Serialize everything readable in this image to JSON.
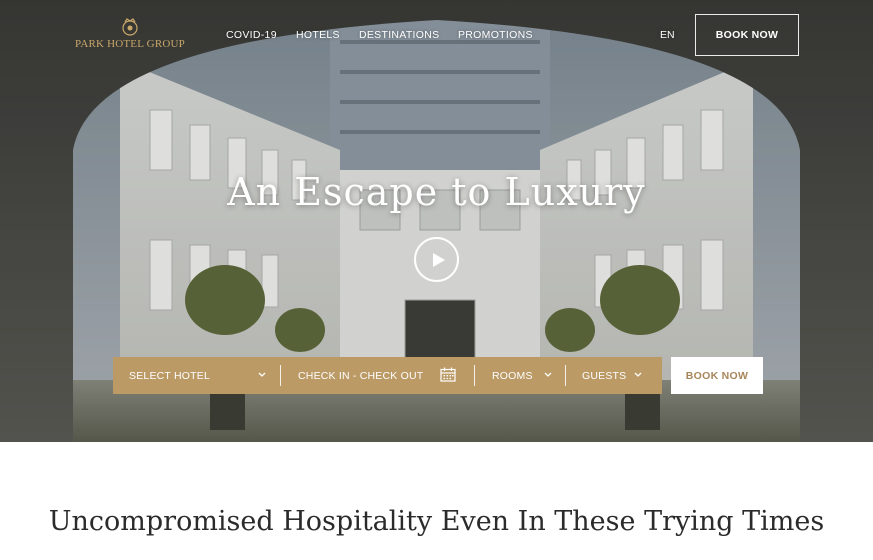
{
  "brand": {
    "logo_text": "PARK HOTEL GROUP",
    "gold": "#c9a86a",
    "booking_bar_color": "#bb9a66",
    "book_now_text_color": "#a8865a"
  },
  "nav": {
    "items": [
      {
        "label": "COVID-19"
      },
      {
        "label": "HOTELS"
      },
      {
        "label": "DESTINATIONS"
      },
      {
        "label": "PROMOTIONS"
      }
    ],
    "language": "EN",
    "book_now": "BOOK NOW"
  },
  "hero": {
    "title": "An Escape to Luxury",
    "play_icon": "play-icon"
  },
  "booking": {
    "hotel": {
      "label": "SELECT HOTEL",
      "icon": "chevron-down-icon"
    },
    "dates": {
      "label": "CHECK IN - CHECK OUT",
      "icon": "calendar-icon"
    },
    "rooms": {
      "label": "ROOMS",
      "icon": "chevron-down-icon"
    },
    "guests": {
      "label": "GUESTS",
      "icon": "chevron-down-icon"
    },
    "submit": "BOOK NOW"
  },
  "content": {
    "title": "Uncompromised Hospitality Even In These Trying Times"
  }
}
